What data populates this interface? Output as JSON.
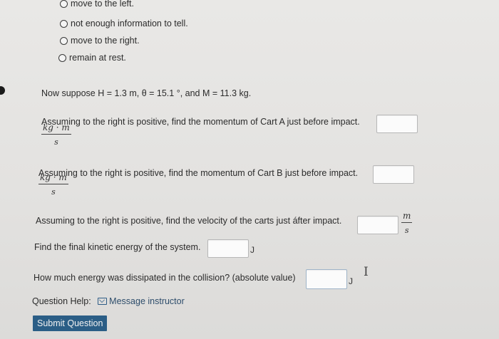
{
  "options": [
    {
      "label": "move to the left."
    },
    {
      "label": "not enough information to tell."
    },
    {
      "label": "move to the right."
    },
    {
      "label": "remain at rest."
    }
  ],
  "given": "Now suppose H = 1.3 m, θ = 15.1 °, and M = 11.3 kg.",
  "questions": {
    "q1": {
      "text": "Assuming to the right is positive, find the momentum of Cart A just before impact.",
      "unit_num": "kg · m",
      "unit_den": "s"
    },
    "q2": {
      "text": "Assuming to the right is positive, find the momentum of Cart B just before impact.",
      "unit_num": "kg · m",
      "unit_den": "s"
    },
    "q3": {
      "text": "Assuming to the right is positive, find the velocity of the carts just áfter impact.",
      "unit_num": "m",
      "unit_den": "s"
    },
    "q4": {
      "text": "Find the final kinetic energy of the system.",
      "unit": "J"
    },
    "q5": {
      "text": "How much energy was dissipated in the collision? (absolute value)",
      "unit": "J"
    }
  },
  "help": {
    "label": "Question Help:",
    "message_link": "Message instructor"
  },
  "submit_label": "Submit Question",
  "colors": {
    "submit_bg": "#2b5e86",
    "link": "#2e4d6b"
  }
}
